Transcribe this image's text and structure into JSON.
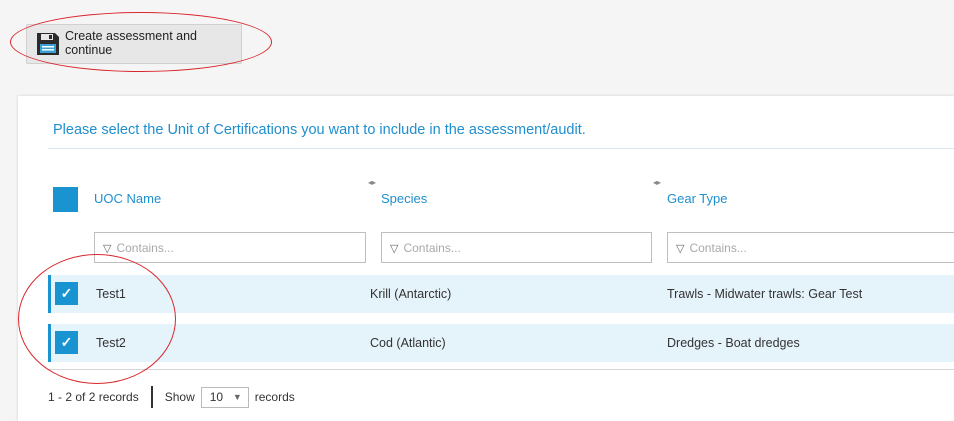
{
  "toolbar": {
    "create_label": "Create assessment and continue",
    "create_icon": "save-icon"
  },
  "panel": {
    "instruction": "Please select the Unit of Certifications you want to include in the assessment/audit."
  },
  "grid": {
    "columns": [
      {
        "label": "UOC Name",
        "filter_placeholder": "Contains..."
      },
      {
        "label": "Species",
        "filter_placeholder": "Contains..."
      },
      {
        "label": "Gear Type",
        "filter_placeholder": "Contains..."
      }
    ],
    "rows": [
      {
        "selected": true,
        "uoc_name": "Test1",
        "species": "Krill (Antarctic)",
        "gear_type": "Trawls - Midwater trawls: Gear Test"
      },
      {
        "selected": true,
        "uoc_name": "Test2",
        "species": "Cod (Atlantic)",
        "gear_type": "Dredges - Boat dredges"
      }
    ],
    "accent_color": "#1a93d1",
    "selected_row_bg": "#e5f3fb"
  },
  "pager": {
    "summary": "1 - 2 of 2 records",
    "show_label": "Show",
    "page_size": "10",
    "records_label": "records"
  },
  "annotation_color": "#d9262b"
}
